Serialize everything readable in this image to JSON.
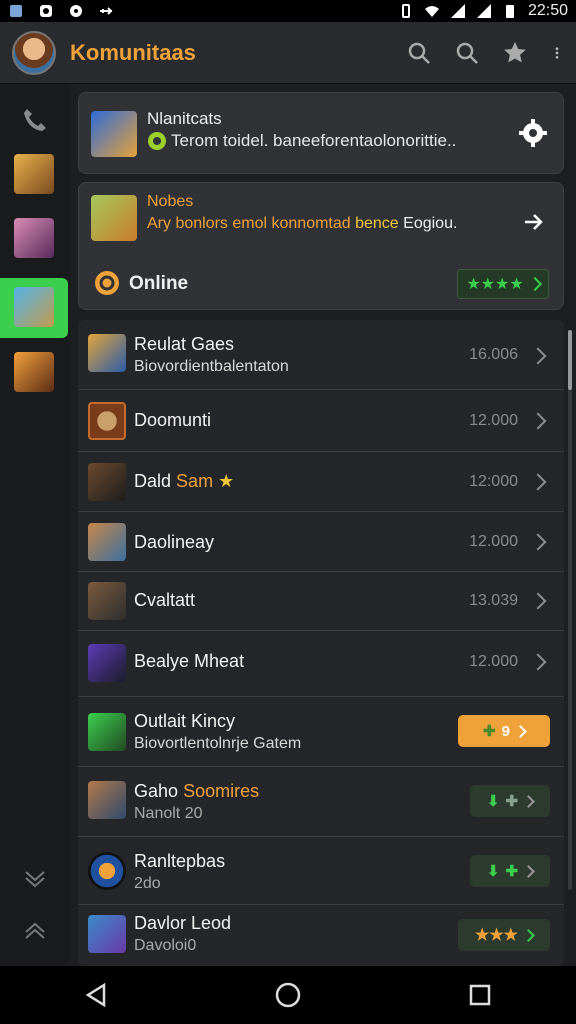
{
  "status": {
    "time": "22:50"
  },
  "appbar": {
    "title": "Komunitaas"
  },
  "card1": {
    "title": "Nlanitcats",
    "subtitle": "Terom toidel. baneeforentaolonorittie.."
  },
  "card2": {
    "title": "Nobes",
    "subtitle_a": "Ary bonlors emol konnomtad",
    "subtitle_b": " bence",
    "subtitle_c": " Eogiou.",
    "online_label": "Online",
    "rating_stars": "★★★★"
  },
  "rows": [
    {
      "title": "Reulat Gaes",
      "subtitle": "Biovordientbalentaton",
      "value": "16.006"
    },
    {
      "title": "Doomunti",
      "value": "12.000"
    },
    {
      "title": "Dald",
      "title_b": "Sam",
      "value": "12:000"
    },
    {
      "title": "Daolineay",
      "value": "12.000"
    },
    {
      "title": "Cvaltatt",
      "value": "13.039"
    },
    {
      "title": "Bealye Mheat",
      "value": "12.000"
    },
    {
      "title": "Outlait Kincy",
      "subtitle": "Biovortlentolnrje Gatem",
      "pill": "9"
    },
    {
      "title": "Gaho",
      "title_b": "Soomires",
      "subtitle": "Nanolt 20"
    },
    {
      "title": "Ranltepbas",
      "subtitle": "2do"
    },
    {
      "title": "Davlor Leod",
      "subtitle": "Davoloi0",
      "stars": "★★★"
    }
  ],
  "colors": {
    "accent": "#f0a23a",
    "green": "#3ccf4e",
    "bg": "#1d1e20"
  }
}
